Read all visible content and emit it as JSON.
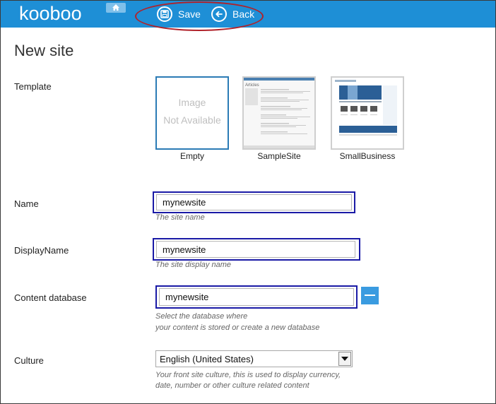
{
  "app": {
    "logo_text": "kooboo"
  },
  "toolbar": {
    "save_label": "Save",
    "back_label": "Back"
  },
  "page": {
    "title": "New site"
  },
  "template": {
    "label": "Template",
    "placeholder_line1": "Image",
    "placeholder_line2": "Not Available",
    "items": [
      {
        "name": "Empty",
        "selected": true
      },
      {
        "name": "SampleSite",
        "selected": false
      },
      {
        "name": "SmallBusiness",
        "selected": false
      }
    ],
    "samplesite_heading": "Articles"
  },
  "fields": {
    "name": {
      "label": "Name",
      "value": "mynewsite",
      "hint": "The site name"
    },
    "display_name": {
      "label": "DisplayName",
      "value": "mynewsite",
      "hint": "The site display name"
    },
    "content_db": {
      "label": "Content database",
      "value": "mynewsite",
      "hint_line1": "Select the database where",
      "hint_line2": "your content is stored or create a new database"
    },
    "culture": {
      "label": "Culture",
      "value": "English (United States)",
      "hint_line1": "Your front site culture, this is used to display currency,",
      "hint_line2": "date, number or other culture related content"
    }
  },
  "colors": {
    "header": "#1e8fd6",
    "highlight_border": "#1a1aa6",
    "annotation": "#b0222a",
    "accent_button": "#3a9be0"
  }
}
